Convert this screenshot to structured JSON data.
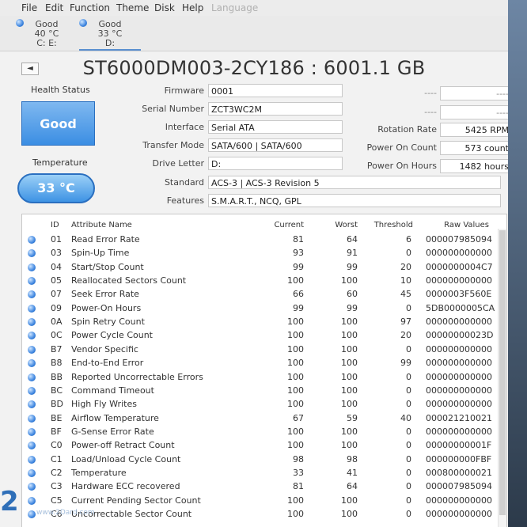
{
  "menu": [
    "File",
    "Edit",
    "Function",
    "Theme",
    "Disk",
    "Help",
    "Language"
  ],
  "drives": [
    {
      "status": "Good",
      "temp": "40 °C",
      "letter": "C: E:"
    },
    {
      "status": "Good",
      "temp": "33 °C",
      "letter": "D:"
    }
  ],
  "nav_prev": "◄",
  "model": "ST6000DM003-2CY186 : 6001.1 GB",
  "health": {
    "label": "Health Status",
    "value": "Good"
  },
  "temperature": {
    "label": "Temperature",
    "value": "33 °C"
  },
  "info": {
    "firmware_label": "Firmware",
    "firmware": "0001",
    "serial_label": "Serial Number",
    "serial": "ZCT3WC2M",
    "interface_label": "Interface",
    "interface": "Serial ATA",
    "transfer_label": "Transfer Mode",
    "transfer": "SATA/600 | SATA/600",
    "letter_label": "Drive Letter",
    "letter": "D:",
    "standard_label": "Standard",
    "standard": "ACS-3 | ACS-3 Revision 5",
    "features_label": "Features",
    "features": "S.M.A.R.T., NCQ, GPL"
  },
  "right_info": {
    "blank1_label": "----",
    "blank1": "----",
    "blank2_label": "----",
    "blank2": "----",
    "rotation_label": "Rotation Rate",
    "rotation": "5425 RPM",
    "poweron_count_label": "Power On Count",
    "poweron_count": "573 count",
    "poweron_hours_label": "Power On Hours",
    "poweron_hours": "1482 hours"
  },
  "table": {
    "headers": {
      "id": "ID",
      "name": "Attribute Name",
      "current": "Current",
      "worst": "Worst",
      "threshold": "Threshold",
      "raw": "Raw Values"
    },
    "rows": [
      {
        "id": "01",
        "name": "Read Error Rate",
        "current": "81",
        "worst": "64",
        "threshold": "6",
        "raw": "000007985094"
      },
      {
        "id": "03",
        "name": "Spin-Up Time",
        "current": "93",
        "worst": "91",
        "threshold": "0",
        "raw": "000000000000"
      },
      {
        "id": "04",
        "name": "Start/Stop Count",
        "current": "99",
        "worst": "99",
        "threshold": "20",
        "raw": "0000000004C7"
      },
      {
        "id": "05",
        "name": "Reallocated Sectors Count",
        "current": "100",
        "worst": "100",
        "threshold": "10",
        "raw": "000000000000"
      },
      {
        "id": "07",
        "name": "Seek Error Rate",
        "current": "66",
        "worst": "60",
        "threshold": "45",
        "raw": "0000003F560E"
      },
      {
        "id": "09",
        "name": "Power-On Hours",
        "current": "99",
        "worst": "99",
        "threshold": "0",
        "raw": "5DB0000005CA"
      },
      {
        "id": "0A",
        "name": "Spin Retry Count",
        "current": "100",
        "worst": "100",
        "threshold": "97",
        "raw": "000000000000"
      },
      {
        "id": "0C",
        "name": "Power Cycle Count",
        "current": "100",
        "worst": "100",
        "threshold": "20",
        "raw": "00000000023D"
      },
      {
        "id": "B7",
        "name": "Vendor Specific",
        "current": "100",
        "worst": "100",
        "threshold": "0",
        "raw": "000000000000"
      },
      {
        "id": "B8",
        "name": "End-to-End Error",
        "current": "100",
        "worst": "100",
        "threshold": "99",
        "raw": "000000000000"
      },
      {
        "id": "BB",
        "name": "Reported Uncorrectable Errors",
        "current": "100",
        "worst": "100",
        "threshold": "0",
        "raw": "000000000000"
      },
      {
        "id": "BC",
        "name": "Command Timeout",
        "current": "100",
        "worst": "100",
        "threshold": "0",
        "raw": "000000000000"
      },
      {
        "id": "BD",
        "name": "High Fly Writes",
        "current": "100",
        "worst": "100",
        "threshold": "0",
        "raw": "000000000000"
      },
      {
        "id": "BE",
        "name": "Airflow Temperature",
        "current": "67",
        "worst": "59",
        "threshold": "40",
        "raw": "000021210021"
      },
      {
        "id": "BF",
        "name": "G-Sense Error Rate",
        "current": "100",
        "worst": "100",
        "threshold": "0",
        "raw": "000000000000"
      },
      {
        "id": "C0",
        "name": "Power-off Retract Count",
        "current": "100",
        "worst": "100",
        "threshold": "0",
        "raw": "00000000001F"
      },
      {
        "id": "C1",
        "name": "Load/Unload Cycle Count",
        "current": "98",
        "worst": "98",
        "threshold": "0",
        "raw": "000000000FBF"
      },
      {
        "id": "C2",
        "name": "Temperature",
        "current": "33",
        "worst": "41",
        "threshold": "0",
        "raw": "000800000021"
      },
      {
        "id": "C3",
        "name": "Hardware ECC recovered",
        "current": "81",
        "worst": "64",
        "threshold": "0",
        "raw": "000007985094"
      },
      {
        "id": "C5",
        "name": "Current Pending Sector Count",
        "current": "100",
        "worst": "100",
        "threshold": "0",
        "raw": "000000000000"
      },
      {
        "id": "C6",
        "name": "Uncorrectable Sector Count",
        "current": "100",
        "worst": "100",
        "threshold": "0",
        "raw": "000000000000"
      }
    ]
  },
  "logo": "2",
  "watermark": "www.2Dard.com"
}
